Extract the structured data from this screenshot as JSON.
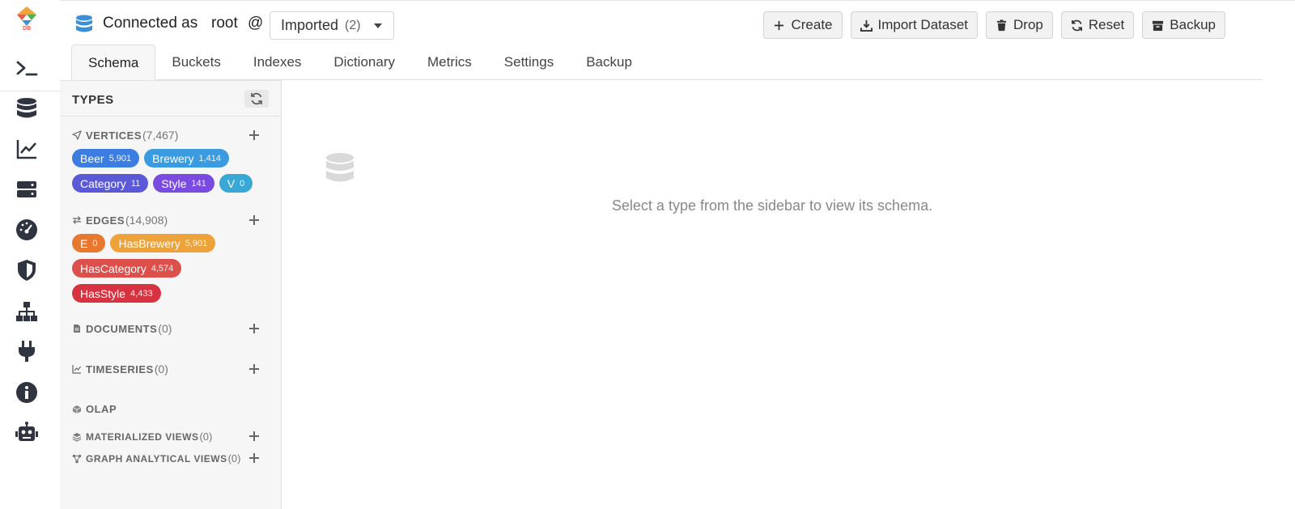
{
  "header": {
    "connected_prefix": "Connected as",
    "user": "root",
    "at": "@",
    "database": "Imported",
    "database_count": "(2)"
  },
  "actions": [
    {
      "label": "Create",
      "icon": "plus-icon"
    },
    {
      "label": "Import Dataset",
      "icon": "download-icon"
    },
    {
      "label": "Drop",
      "icon": "trash-icon"
    },
    {
      "label": "Reset",
      "icon": "refresh-icon"
    },
    {
      "label": "Backup",
      "icon": "archive-icon"
    }
  ],
  "tabs": [
    {
      "label": "Schema",
      "active": true
    },
    {
      "label": "Buckets"
    },
    {
      "label": "Indexes"
    },
    {
      "label": "Dictionary"
    },
    {
      "label": "Metrics"
    },
    {
      "label": "Settings"
    },
    {
      "label": "Backup"
    }
  ],
  "rail": {
    "logo_text": "DB",
    "icons": [
      "terminal-icon",
      "database-icon",
      "chart-icon",
      "server-icon",
      "dashboard-icon",
      "shield-icon",
      "network-icon",
      "plug-icon",
      "info-icon",
      "robot-icon"
    ]
  },
  "sidebar": {
    "title": "TYPES",
    "vertices": {
      "label": "VERTICES",
      "count": "(7,467)",
      "items": [
        {
          "name": "Beer",
          "count": "5,901",
          "color": "#3b7de0"
        },
        {
          "name": "Brewery",
          "count": "1,414",
          "color": "#3a9be0"
        },
        {
          "name": "Category",
          "count": "11",
          "color": "#5b59d6"
        },
        {
          "name": "Style",
          "count": "141",
          "color": "#7a4be0"
        },
        {
          "name": "V",
          "count": "0",
          "color": "#3aa8d4"
        }
      ]
    },
    "edges": {
      "label": "EDGES",
      "count": "(14,908)",
      "items": [
        {
          "name": "E",
          "count": "0",
          "color": "#e8782e"
        },
        {
          "name": "HasBrewery",
          "count": "5,901",
          "color": "#eda23a"
        },
        {
          "name": "HasCategory",
          "count": "4,574",
          "color": "#dc4f4b"
        },
        {
          "name": "HasStyle",
          "count": "4,433",
          "color": "#d6323f"
        }
      ]
    },
    "documents": {
      "label": "DOCUMENTS",
      "count": "(0)"
    },
    "timeseries": {
      "label": "TIMESERIES",
      "count": "(0)"
    },
    "olap": {
      "label": "OLAP"
    },
    "materialized_views": {
      "label": "MATERIALIZED VIEWS",
      "count": "(0)"
    },
    "graph_analytical_views": {
      "label": "GRAPH ANALYTICAL VIEWS",
      "count": "(0)"
    }
  },
  "main": {
    "empty_message": "Select a type from the sidebar to view its schema."
  },
  "colors": {
    "accent": "#3a8fd6",
    "icon_dark": "#2e3540"
  }
}
